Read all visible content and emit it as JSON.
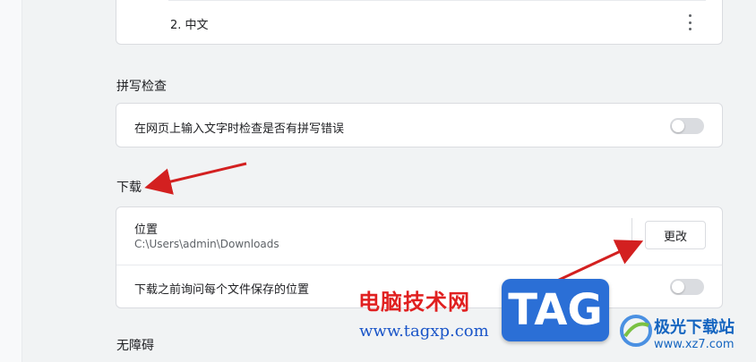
{
  "languages": {
    "item_2": "2. 中文",
    "more_icon": "more-vert-icon"
  },
  "spellcheck": {
    "title": "拼写检查",
    "row_text": "在网页上输入文字时检查是否有拼写错误",
    "toggle_on": false
  },
  "downloads": {
    "title": "下载",
    "location_label": "位置",
    "location_path": "C:\\Users\\admin\\Downloads",
    "change_button": "更改",
    "ask_text": "下载之前询问每个文件保存的位置",
    "ask_toggle_on": false
  },
  "accessibility": {
    "title": "无障碍"
  },
  "watermark": {
    "site_name_cn": "电脑技术网",
    "site_url": "www.tagxp.com",
    "tag_text": "TAG",
    "brand_name": "极光下载站",
    "brand_url": "www.xz7.com"
  },
  "colors": {
    "background": "#f1f3f4",
    "card": "#ffffff",
    "border": "#dadce0",
    "annotation_arrow": "#d32020",
    "toggle_off": "#dadce0"
  }
}
